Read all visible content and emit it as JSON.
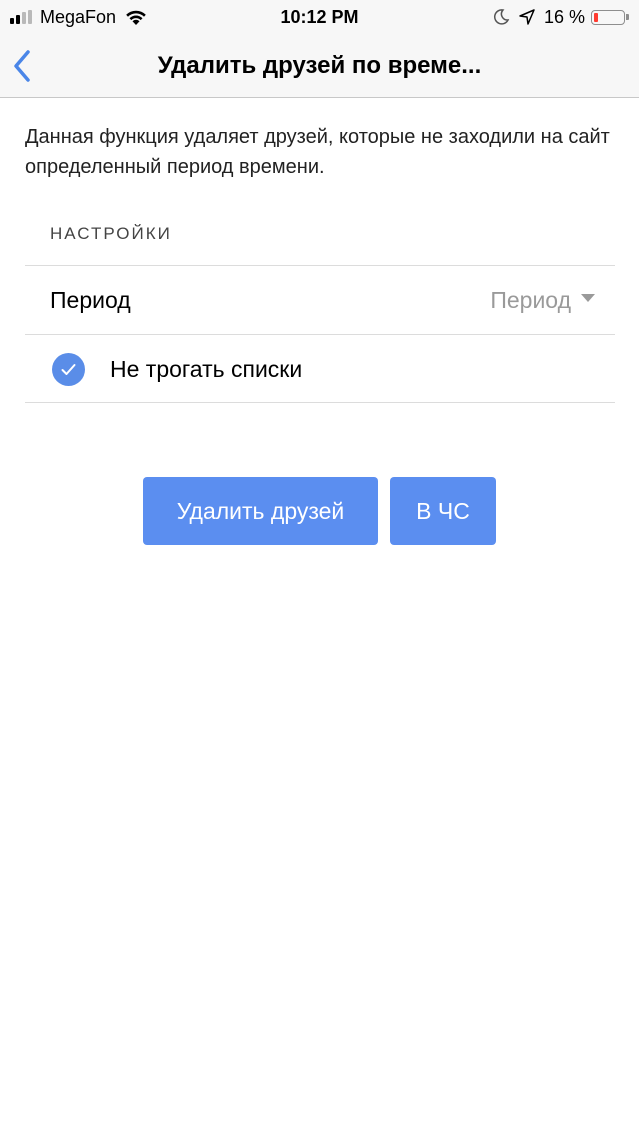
{
  "status_bar": {
    "carrier": "MegaFon",
    "time": "10:12 PM",
    "battery_percent": "16 %",
    "battery_level": 0.16,
    "signal_bars_active": 2,
    "signal_bars_total": 4,
    "battery_color": "#ff3b30"
  },
  "nav": {
    "title": "Удалить друзей по време...",
    "back_icon": "chevron-left-icon",
    "accent_color": "#4a86e8"
  },
  "content": {
    "description": "Данная функция удаляет друзей, которые не заходили на сайт определенный период времени.",
    "section_header": "НАСТРОЙКИ",
    "period_label": "Период",
    "period_value": "Период",
    "keep_lists_label": "Не трогать списки",
    "keep_lists_checked": true
  },
  "buttons": {
    "delete_label": "Удалить друзей",
    "blacklist_label": "В ЧС",
    "color": "#5b8ef0"
  }
}
